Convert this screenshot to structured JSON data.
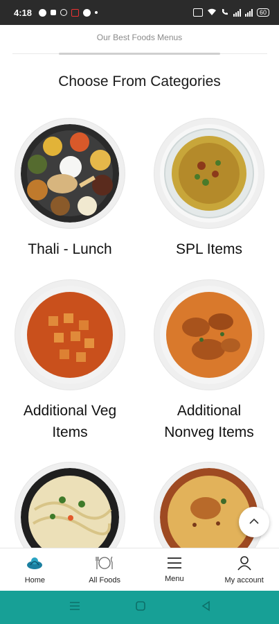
{
  "status_bar": {
    "time": "4:18",
    "battery": "60"
  },
  "header": {
    "subtitle": "Our Best Foods Menus"
  },
  "section": {
    "heading": "Choose From Categories"
  },
  "categories": [
    {
      "label": "Thali - Lunch",
      "image": "thali-plate-image"
    },
    {
      "label": "SPL Items",
      "image": "dal-bowl-image"
    },
    {
      "label_line1": "Additional Veg",
      "label_line2": "Items",
      "image": "paneer-curry-image"
    },
    {
      "label_line1": "Additional",
      "label_line2": "Nonveg Items",
      "image": "chicken-curry-image"
    },
    {
      "label": "",
      "image": "noodles-image"
    },
    {
      "label": "",
      "image": "biryani-image"
    }
  ],
  "bottom_nav": [
    {
      "label": "Home",
      "icon": "home-logo-icon"
    },
    {
      "label": "All Foods",
      "icon": "cutlery-icon"
    },
    {
      "label": "Menu",
      "icon": "hamburger-menu-icon"
    },
    {
      "label": "My account",
      "icon": "person-icon"
    }
  ],
  "colors": {
    "accent": "#17a096",
    "status_bar": "#2b2b2b"
  }
}
